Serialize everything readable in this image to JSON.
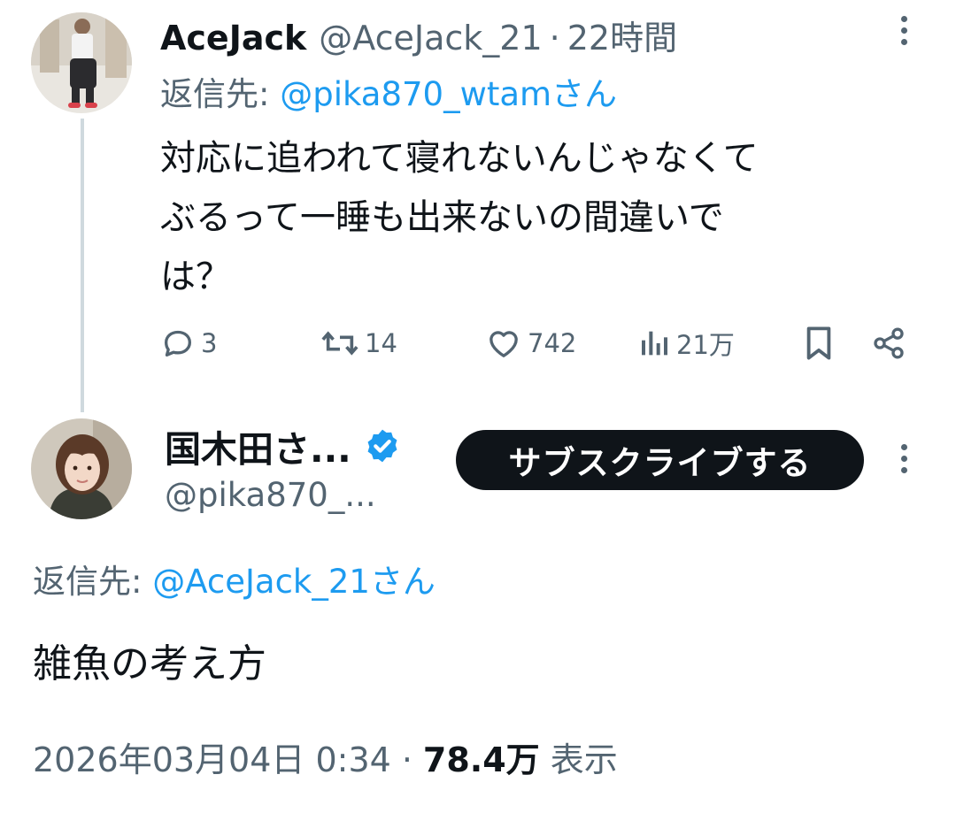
{
  "reply_tweet": {
    "display_name": "AceJack",
    "handle": "@AceJack_21",
    "separator": "·",
    "time_ago": "22時間",
    "reply_prefix": "返信先:",
    "reply_target": "@pika870_wtamさん",
    "text_lines": [
      "対応に追われて寝れないんじゃなくて",
      "ぶるって一睡も出来ないの間違いで",
      "は？"
    ],
    "actions": {
      "replies": "3",
      "reposts": "14",
      "likes": "742",
      "views": "21万"
    }
  },
  "main_tweet": {
    "display_name": "国木田さ...",
    "handle": "@pika870_...",
    "subscribe_label": "サブスクライブする",
    "reply_prefix": "返信先:",
    "reply_target": "@AceJack_21さん",
    "text": "雑魚の考え方",
    "timestamp": "2026年03月04日 0:34",
    "separator": "·",
    "views_count": "78.4万",
    "views_label": "表示"
  },
  "icons": [
    "more-icon",
    "reply-icon",
    "repost-icon",
    "like-icon",
    "views-icon",
    "bookmark-icon",
    "share-icon",
    "verified-badge-icon"
  ],
  "colors": {
    "link": "#1d9bf0",
    "secondary_text": "#536471",
    "verified": "#1d9bf0",
    "button_bg": "#0f1419"
  }
}
